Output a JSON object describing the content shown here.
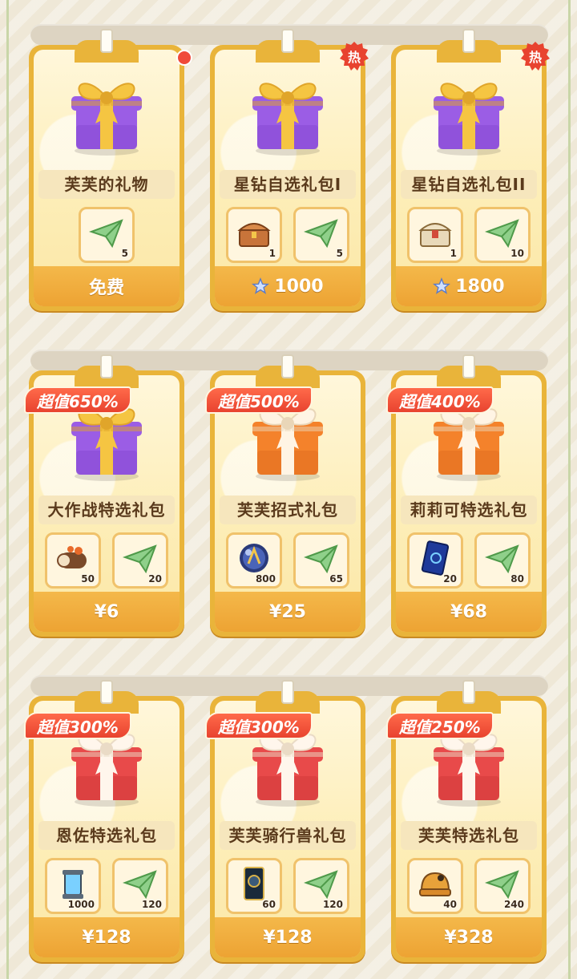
{
  "cards": [
    {
      "name": "芙芙的礼物",
      "gift": "purple",
      "badge": "dot",
      "promo": "",
      "items": [
        {
          "icon": "paper-plane",
          "qty": "5"
        }
      ],
      "price": {
        "label": "免费",
        "currency": "none"
      }
    },
    {
      "name": "星钻自选礼包I",
      "gift": "purple",
      "badge": "hot",
      "promo": "",
      "items": [
        {
          "icon": "treasure-chest",
          "qty": "1"
        },
        {
          "icon": "paper-plane",
          "qty": "5"
        }
      ],
      "price": {
        "label": "1000",
        "currency": "star"
      }
    },
    {
      "name": "星钻自选礼包II",
      "gift": "purple",
      "badge": "hot",
      "promo": "",
      "items": [
        {
          "icon": "treasure-chest-gold",
          "qty": "1"
        },
        {
          "icon": "paper-plane",
          "qty": "10"
        }
      ],
      "price": {
        "label": "1800",
        "currency": "star"
      }
    },
    {
      "name": "大作战特选礼包",
      "gift": "purple",
      "badge": "",
      "promo": "超值650%",
      "items": [
        {
          "icon": "food-roll",
          "qty": "50"
        },
        {
          "icon": "paper-plane",
          "qty": "20"
        }
      ],
      "price": {
        "label": "¥6",
        "currency": "yen"
      }
    },
    {
      "name": "芙芙招式礼包",
      "gift": "orange",
      "badge": "",
      "promo": "超值500%",
      "items": [
        {
          "icon": "crystal-orb",
          "qty": "800"
        },
        {
          "icon": "paper-plane",
          "qty": "65"
        }
      ],
      "price": {
        "label": "¥25",
        "currency": "yen"
      }
    },
    {
      "name": "莉莉可特选礼包",
      "gift": "orange",
      "badge": "",
      "promo": "超值400%",
      "items": [
        {
          "icon": "blue-card",
          "qty": "20"
        },
        {
          "icon": "paper-plane",
          "qty": "80"
        }
      ],
      "price": {
        "label": "¥68",
        "currency": "yen"
      }
    },
    {
      "name": "恩佐特选礼包",
      "gift": "red",
      "badge": "",
      "promo": "超值300%",
      "items": [
        {
          "icon": "energy-canister",
          "qty": "1000"
        },
        {
          "icon": "paper-plane",
          "qty": "120"
        }
      ],
      "price": {
        "label": "¥128",
        "currency": "yen"
      }
    },
    {
      "name": "芙芙骑行兽礼包",
      "gift": "red",
      "badge": "",
      "promo": "超值300%",
      "items": [
        {
          "icon": "dark-card",
          "qty": "60"
        },
        {
          "icon": "paper-plane",
          "qty": "120"
        }
      ],
      "price": {
        "label": "¥128",
        "currency": "yen"
      }
    },
    {
      "name": "芙芙特选礼包",
      "gift": "red",
      "badge": "",
      "promo": "超值250%",
      "items": [
        {
          "icon": "helmet",
          "qty": "40"
        },
        {
          "icon": "paper-plane",
          "qty": "240"
        }
      ],
      "price": {
        "label": "¥328",
        "currency": "yen"
      }
    }
  ],
  "colors": {
    "card_gold": "#e9b43a",
    "price_bar": "#eda333",
    "promo_red": "#e8432f",
    "hot_badge": "#e8432f",
    "background": "#efe8d7"
  }
}
